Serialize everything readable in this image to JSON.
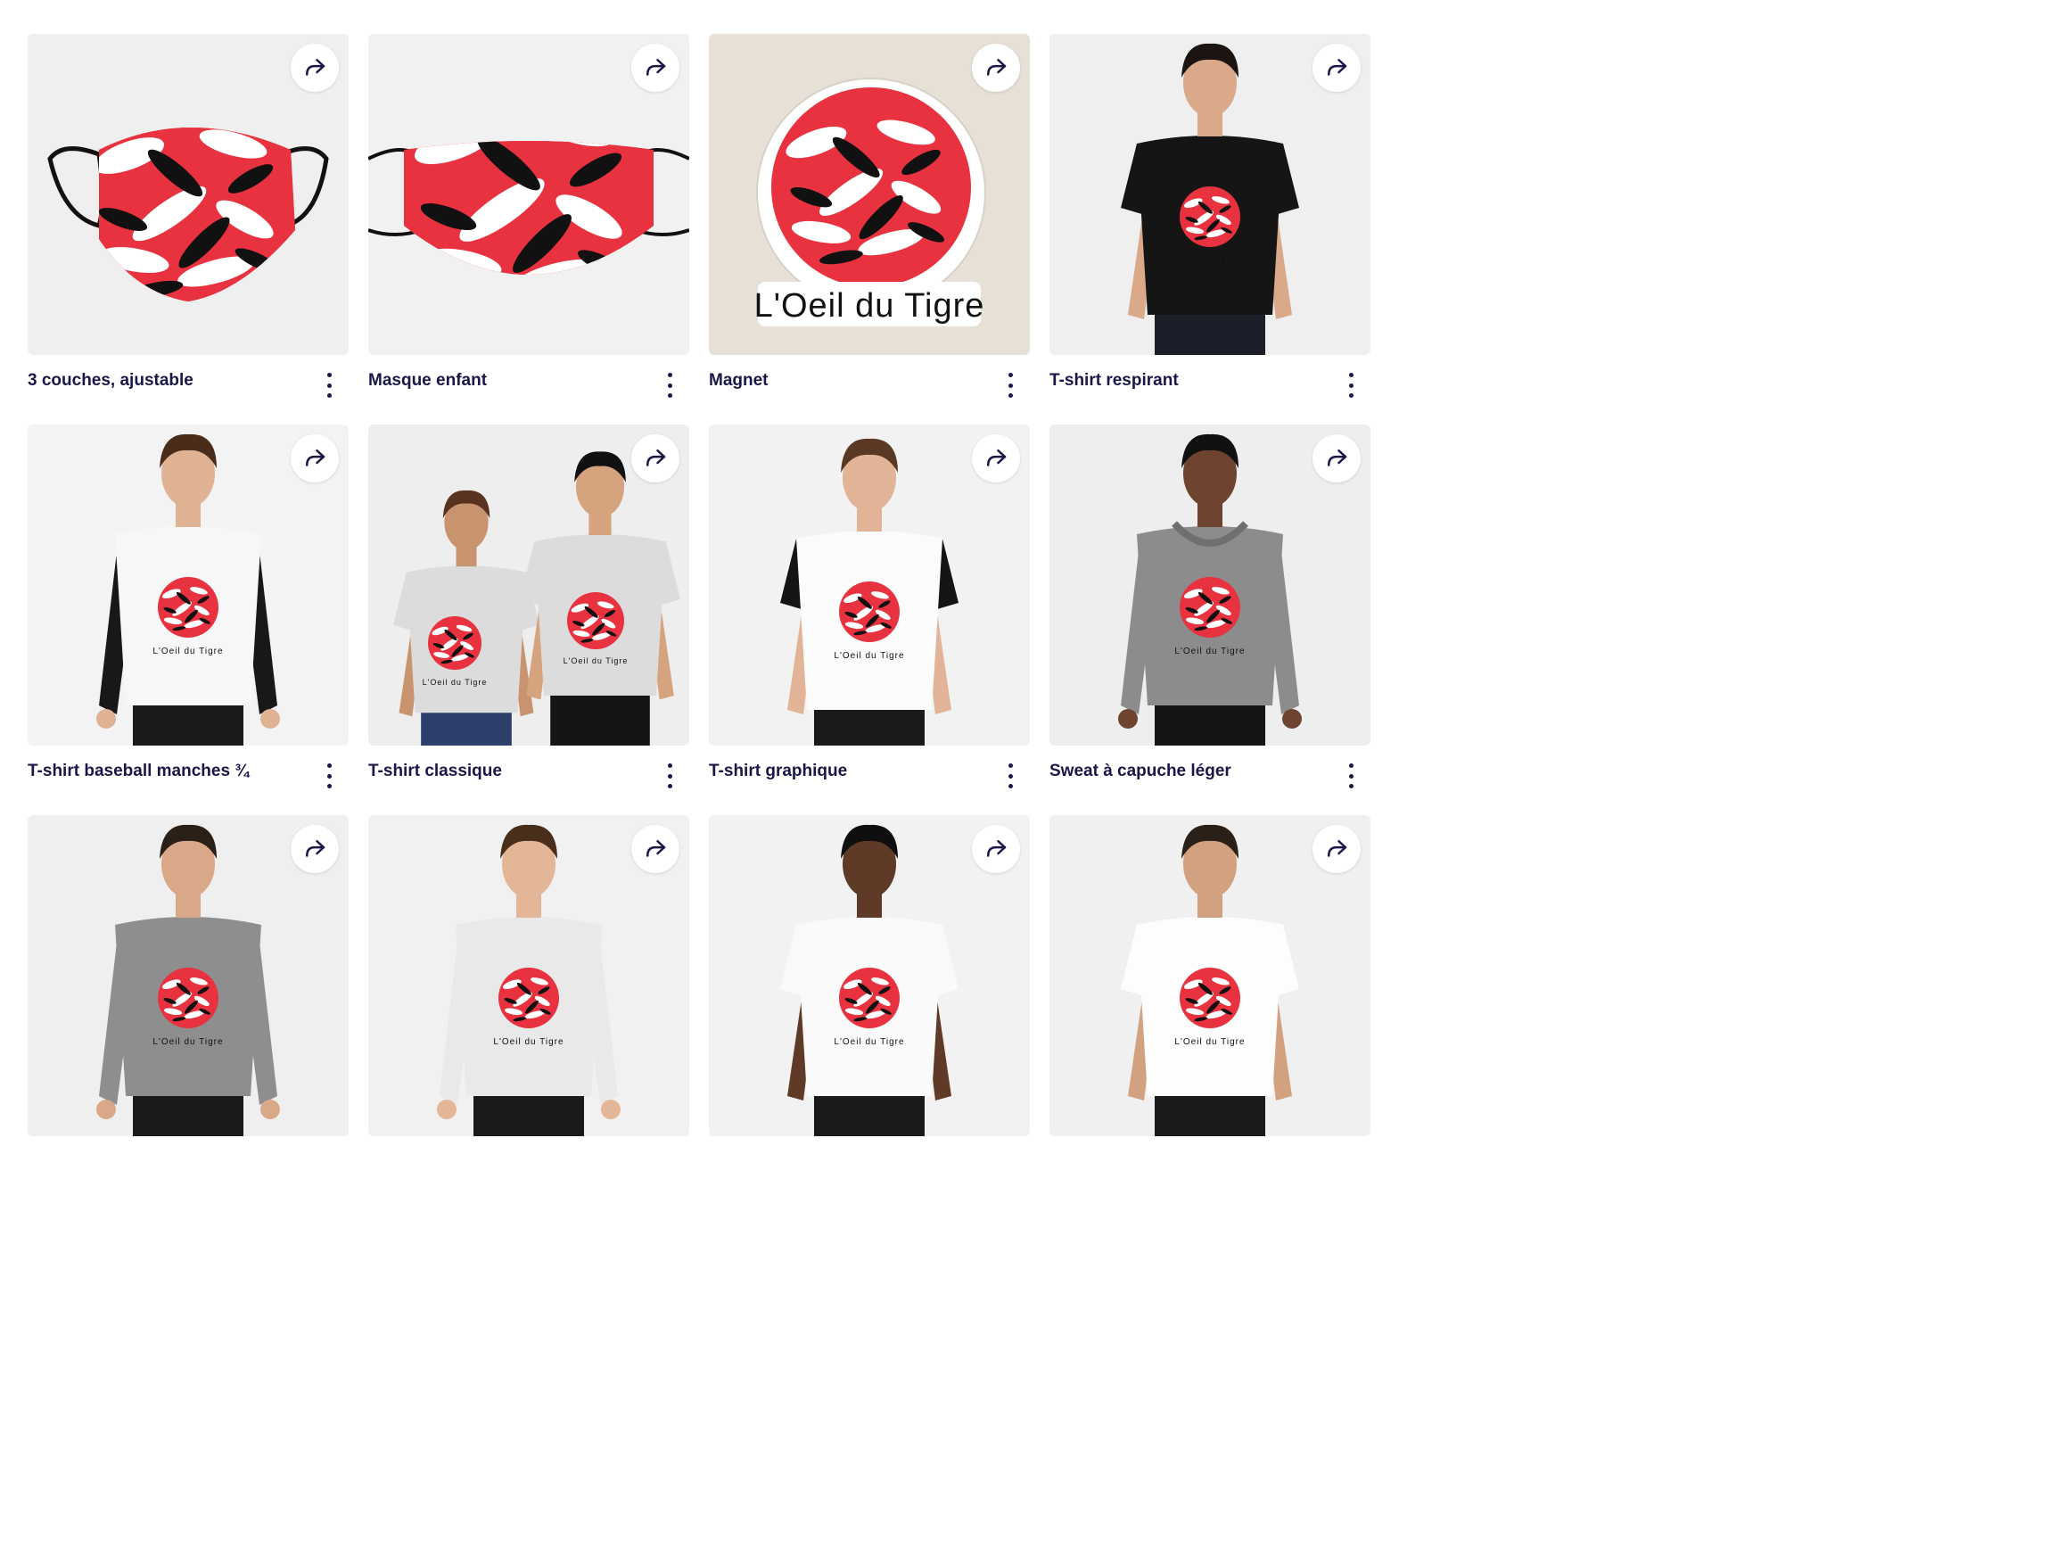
{
  "colors": {
    "title": "#1a1748",
    "accent_red": "#e8323f",
    "ink": "#111111"
  },
  "icons": {
    "share": "share-arrow-icon",
    "more": "more-vertical-icon"
  },
  "logo_text": "L'Oeil du Tigre",
  "products": [
    {
      "title": "3 couches, ajustable",
      "type": "mask3d",
      "bg": "#efefef"
    },
    {
      "title": "Masque enfant",
      "type": "maskflat",
      "bg": "#f1f1f1"
    },
    {
      "title": "Magnet",
      "type": "magnet",
      "bg": "#e6e0d6"
    },
    {
      "title": "T-shirt respirant",
      "type": "tee",
      "bg": "#efeff0",
      "shirt": "#151515",
      "skin": "#d9a98a",
      "hair": "#1b1410",
      "pants": "#1c1f2a"
    },
    {
      "title": "T-shirt baseball manches ¾",
      "type": "raglan",
      "bg": "#f3f3f3",
      "shirt": "#f7f7f7",
      "sleeve": "#181818",
      "skin": "#e0b294",
      "hair": "#4a2c1b",
      "pants": "#1a1a1a"
    },
    {
      "title": "T-shirt classique",
      "type": "duo",
      "bg": "#eeeeee",
      "shirt": "#dcdcdc",
      "skin": "#c8946f",
      "hair": "#5a3220",
      "pants": "#2d3f6b"
    },
    {
      "title": "T-shirt graphique",
      "type": "graphic",
      "bg": "#f2f2f2",
      "shirt": "#fbfbfb",
      "sleeve": "#151515",
      "skin": "#e2b497",
      "hair": "#5b3823",
      "pants": "#1a1a1a"
    },
    {
      "title": "Sweat à capuche léger",
      "type": "hoodie",
      "bg": "#eeeeee",
      "shirt": "#8c8c8c",
      "skin": "#6e4430",
      "hair": "#111111",
      "pants": "#151515"
    },
    {
      "title": "",
      "type": "longsleeve",
      "bg": "#efefef",
      "shirt": "#8e8e8e",
      "skin": "#d9a888",
      "hair": "#2a2018",
      "pants": "#1a1a1a"
    },
    {
      "title": "",
      "type": "longsleeve",
      "bg": "#f1f1f1",
      "shirt": "#e9e9e9",
      "skin": "#e4b698",
      "hair": "#4a2e1c",
      "pants": "#1a1a1a"
    },
    {
      "title": "",
      "type": "tee",
      "bg": "#f2f2f2",
      "shirt": "#fafafa",
      "skin": "#5e3a27",
      "hair": "#0f0f0f",
      "pants": "#1a1a1a"
    },
    {
      "title": "",
      "type": "tee",
      "bg": "#f0f0f0",
      "shirt": "#fdfdfd",
      "skin": "#d2a180",
      "hair": "#2b2018",
      "pants": "#1a1a1a"
    }
  ]
}
